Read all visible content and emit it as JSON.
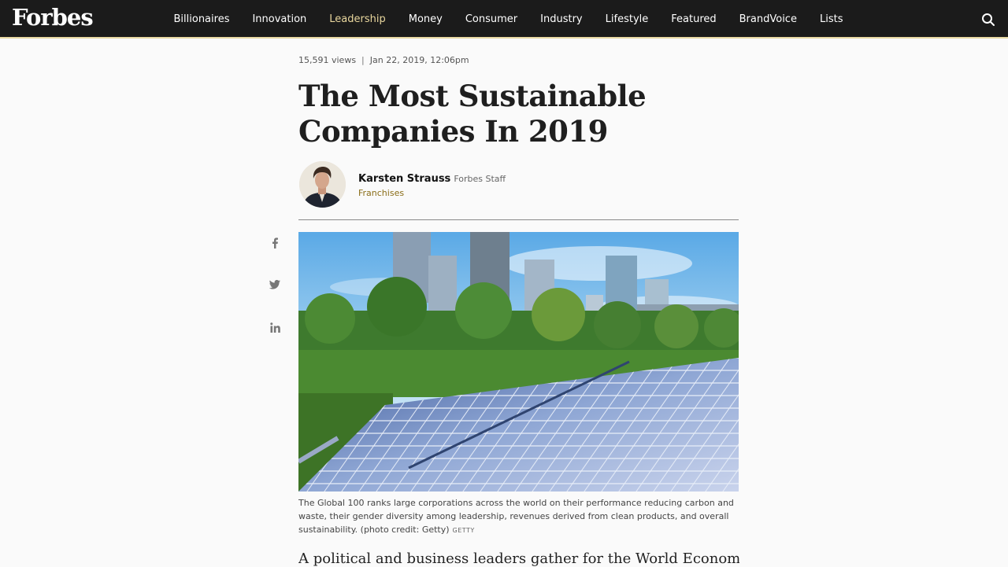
{
  "header": {
    "logo": "Forbes",
    "nav": [
      {
        "label": "Billionaires"
      },
      {
        "label": "Innovation"
      },
      {
        "label": "Leadership",
        "active": true
      },
      {
        "label": "Money"
      },
      {
        "label": "Consumer"
      },
      {
        "label": "Industry"
      },
      {
        "label": "Lifestyle"
      },
      {
        "label": "Featured"
      },
      {
        "label": "BrandVoice"
      },
      {
        "label": "Lists"
      }
    ],
    "search_icon": "search-icon"
  },
  "article": {
    "views": "15,591 views",
    "separator": "|",
    "date": "Jan 22, 2019, 12:06pm",
    "title": "The Most Sustainable Companies In 2019",
    "author": {
      "name": "Karsten Strauss",
      "role": "Forbes Staff",
      "section": "Franchises"
    },
    "share": [
      "facebook-icon",
      "twitter-icon",
      "linkedin-icon"
    ],
    "caption": "The Global 100 ranks large corporations across the world on their performance reducing carbon and waste, their gender diversity among leadership, revenues derived from clean products, and overall sustainability. (photo credit: Getty)",
    "credit": "GETTY",
    "body_start": "A political and business leaders gather for the World Economic Forum in"
  },
  "colors": {
    "nav_bg": "#1b1b1b",
    "accent": "#e8d69d",
    "section_link": "#8a6d18"
  }
}
